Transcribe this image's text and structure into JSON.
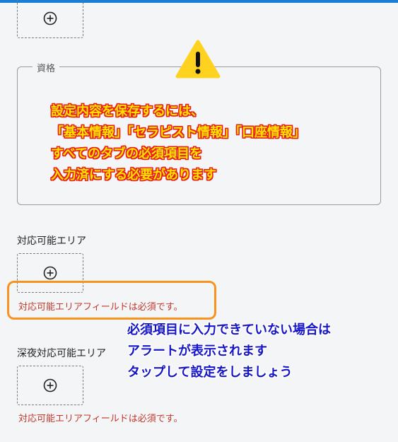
{
  "fields": {
    "qualification": {
      "legend": "資格"
    },
    "service_area": {
      "label": "対応可能エリア",
      "error": "対応可能エリアフィールドは必須です。"
    },
    "night_service_area": {
      "label": "深夜対応可能エリア",
      "error": "対応可能エリアフィールドは必須です。"
    }
  },
  "notice": {
    "icon": "warning-triangle-icon",
    "lines": [
      "設定内容を保存するには、",
      "「基本情報」「セラピスト情報」「口座情報」",
      "すべてのタブの必須項目を",
      "入力済にする必要があります"
    ]
  },
  "annotation": {
    "lines": [
      "必須項目に入力できていない場合は",
      "アラートが表示されます",
      "タップして設定をしましょう"
    ]
  },
  "colors": {
    "accent_bar": "#1a7fd4",
    "error": "#c0392b",
    "highlight": "#f7931e",
    "notice_fill": "#ffe000",
    "notice_outline": "#e8201a",
    "annotation": "#1414c8"
  }
}
